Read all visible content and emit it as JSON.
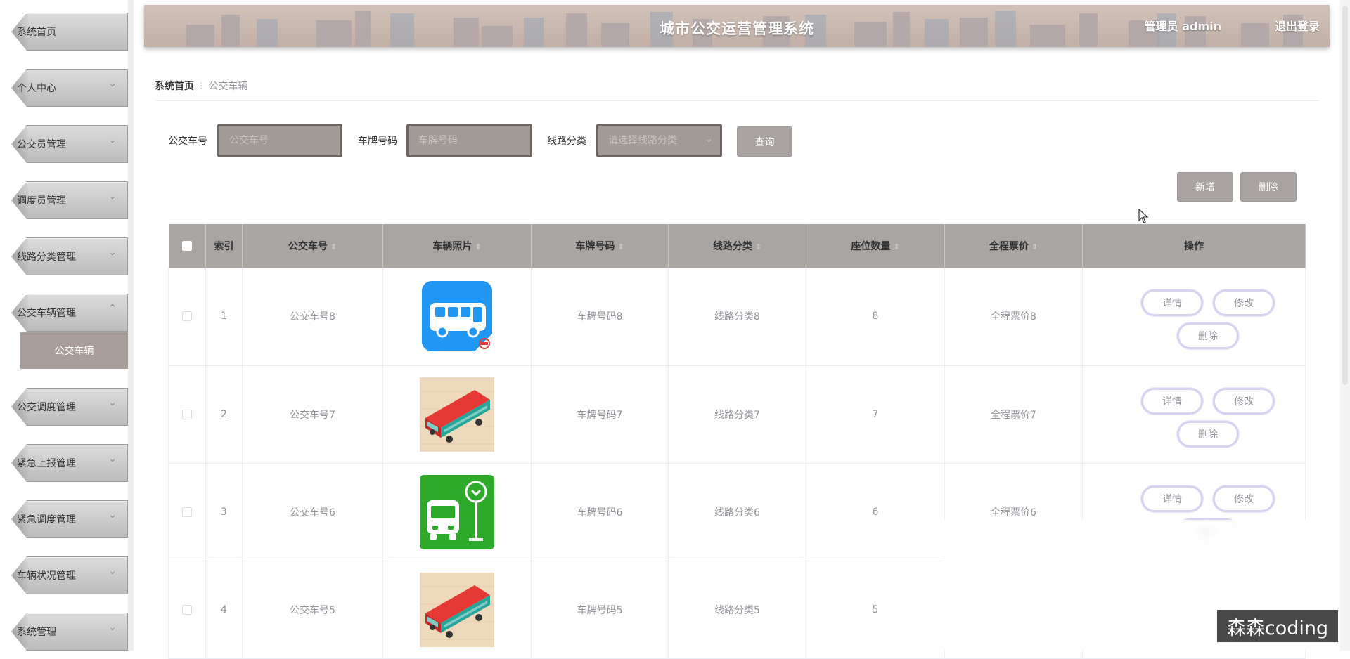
{
  "header": {
    "title": "城市公交运营管理系统",
    "user": "管理员 admin",
    "logout": "退出登录"
  },
  "sidebar": {
    "items": [
      {
        "label": "系统首页",
        "chevron": ""
      },
      {
        "label": "个人中心",
        "chevron": "⌄"
      },
      {
        "label": "公交员管理",
        "chevron": "⌄"
      },
      {
        "label": "调度员管理",
        "chevron": "⌄"
      },
      {
        "label": "线路分类管理",
        "chevron": "⌄"
      },
      {
        "label": "公交车辆管理",
        "chevron": "⌃"
      },
      {
        "label": "公交调度管理",
        "chevron": "⌄"
      },
      {
        "label": "紧急上报管理",
        "chevron": "⌄"
      },
      {
        "label": "紧急调度管理",
        "chevron": "⌄"
      },
      {
        "label": "车辆状况管理",
        "chevron": "⌄"
      },
      {
        "label": "系统管理",
        "chevron": "⌄"
      }
    ],
    "active_sub": "公交车辆"
  },
  "breadcrumb": {
    "home": "系统首页",
    "separator": "⁝",
    "current": "公交车辆"
  },
  "search": {
    "bus_no_label": "公交车号",
    "bus_no_placeholder": "公交车号",
    "plate_label": "车牌号码",
    "plate_placeholder": "车牌号码",
    "route_label": "线路分类",
    "route_placeholder": "请选择线路分类",
    "query_button": "查询"
  },
  "actions": {
    "add": "新增",
    "delete": "删除"
  },
  "table": {
    "headers": [
      "索引",
      "公交车号",
      "车辆照片",
      "车牌号码",
      "线路分类",
      "座位数量",
      "全程票价",
      "操作"
    ],
    "sort_glyph": "⇕",
    "rows": [
      {
        "index": "1",
        "bus_no": "公交车号8",
        "photo": "blue-bus-app-icon",
        "plate": "车牌号码8",
        "route": "线路分类8",
        "seats": "8",
        "fare": "全程票价8"
      },
      {
        "index": "2",
        "bus_no": "公交车号7",
        "photo": "red-bus-isometric-icon",
        "plate": "车牌号码7",
        "route": "线路分类7",
        "seats": "7",
        "fare": "全程票价7"
      },
      {
        "index": "3",
        "bus_no": "公交车号6",
        "photo": "green-bus-stop-icon",
        "plate": "车牌号码6",
        "route": "线路分类6",
        "seats": "6",
        "fare": "全程票价6"
      },
      {
        "index": "4",
        "bus_no": "公交车号5",
        "photo": "red-bus-isometric-icon",
        "plate": "车牌号码5",
        "route": "线路分类5",
        "seats": "5",
        "fare": ""
      }
    ],
    "op_detail": "详情",
    "op_edit": "修改",
    "op_delete": "删除"
  },
  "watermark": "森森coding",
  "colors": {
    "header_bg": "#c9b9b0",
    "table_header_bg": "#a9a5a3",
    "input_bg": "#a29a97",
    "button_bg": "#a8a3a1",
    "sub_active_bg": "#a89d98",
    "op_border": "#d6d2f0"
  }
}
